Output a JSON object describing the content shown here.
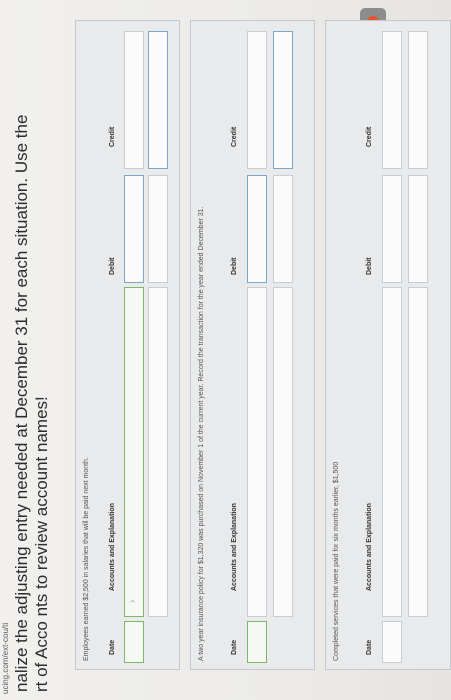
{
  "page": {
    "url": "ucing.com/ext-cou/ti",
    "heading_line1": "nalize the adjusting entry needed at December 31 for each situation. Use the",
    "heading_line2": "rt of Acco  nts to review account names!"
  },
  "columns": {
    "date": "Date",
    "accounts": "Accounts and Explanation",
    "debit": "Debit",
    "credit": "Credit"
  },
  "situations": [
    {
      "prompt": "Employees earned $2,500 in salaries that will be paid next month."
    },
    {
      "prompt": "A two year insurance policy for $1,320 was purchased on November 1 of the current year. Record the transaction for the year ended December 31."
    },
    {
      "prompt": "Completed services that were paid for six months earlier, $1,500"
    }
  ],
  "colors": {
    "orange_dot": "#e5572b",
    "green_border": "#7fb56d"
  }
}
